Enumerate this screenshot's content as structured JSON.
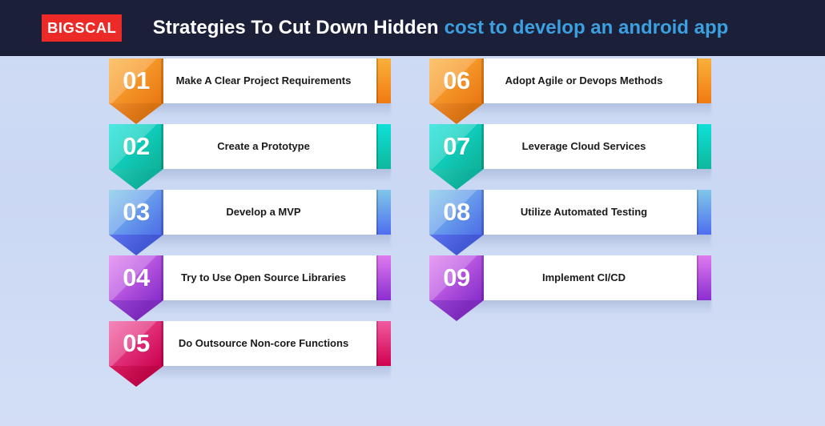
{
  "header": {
    "logo_text": "BIGSCAL",
    "title_primary": "Strategies To Cut Down Hidden",
    "title_accent": "cost to develop an android app",
    "bg_color": "#1c1f38",
    "logo_bg_color": "#ec2a28",
    "accent_color": "#3c9fe0"
  },
  "background_color": "#d0dcf5",
  "columns": [
    {
      "name": "left-column",
      "items": [
        {
          "number": "01",
          "label": "Make A Clear Project Requirements",
          "color_from": "#fbb03b",
          "color_to": "#f07a13",
          "point_color": "#ef7f14"
        },
        {
          "number": "02",
          "label": "Create a Prototype",
          "color_from": "#0fe0d8",
          "color_to": "#0fb79c",
          "point_color": "#0ec4ad"
        },
        {
          "number": "03",
          "label": "Develop a MVP",
          "color_from": "#7fc7e8",
          "color_to": "#4f6ff0",
          "point_color": "#4a63ee"
        },
        {
          "number": "04",
          "label": "Try to Use Open Source Libraries",
          "color_from": "#e07aef",
          "color_to": "#8a2ed0",
          "point_color": "#8c2fd1"
        },
        {
          "number": "05",
          "label": "Do Outsource Non-core Functions",
          "color_from": "#f05ba0",
          "color_to": "#d2004f",
          "point_color": "#d3064f"
        }
      ]
    },
    {
      "name": "right-column",
      "items": [
        {
          "number": "06",
          "label": "Adopt Agile or Devops Methods",
          "color_from": "#fbb03b",
          "color_to": "#f07a13",
          "point_color": "#ef7f14"
        },
        {
          "number": "07",
          "label": "Leverage Cloud Services",
          "color_from": "#0fe0d8",
          "color_to": "#0fb79c",
          "point_color": "#0ec4ad"
        },
        {
          "number": "08",
          "label": "Utilize Automated Testing",
          "color_from": "#7fc7e8",
          "color_to": "#4f6ff0",
          "point_color": "#4a63ee"
        },
        {
          "number": "09",
          "label": "Implement CI/CD",
          "color_from": "#e07aef",
          "color_to": "#8a2ed0",
          "point_color": "#8c2fd1"
        }
      ]
    }
  ]
}
